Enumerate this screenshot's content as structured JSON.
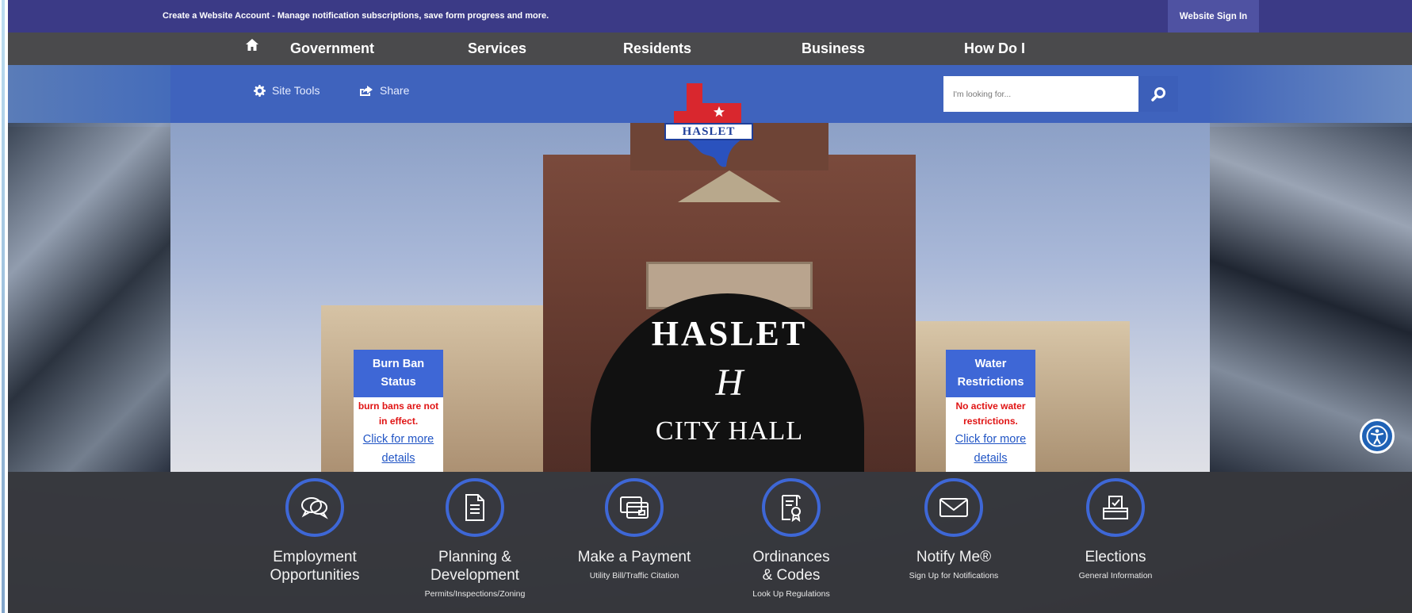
{
  "account_bar": {
    "message": "Create a Website Account - Manage notification subscriptions, save form progress and more.",
    "signin": "Website Sign In"
  },
  "nav": {
    "home_icon": "home-icon",
    "items": [
      "Government",
      "Services",
      "Residents",
      "Business",
      "How Do I"
    ]
  },
  "tools": {
    "site_tools": "Site Tools",
    "share": "Share",
    "search_placeholder": "I'm looking for..."
  },
  "logo": {
    "text": "HASLET"
  },
  "hero": {
    "awning_top": "HASLET",
    "awning_middle": "H",
    "awning_bottom": "CITY HALL"
  },
  "status_cards": [
    {
      "title_line1": "Burn Ban",
      "title_line2": "Status",
      "message_line1": "burn bans are not",
      "message_line2": "in effect.",
      "link_line1": "Click for more",
      "link_line2": "details"
    },
    {
      "title_line1": "Water",
      "title_line2": "Restrictions",
      "message_line1": "No active water",
      "message_line2": "restrictions.",
      "link_line1": "Click for more",
      "link_line2": "details"
    }
  ],
  "quick_links": [
    {
      "title_line1": "Employment",
      "title_line2": "Opportunities",
      "subtitle": "",
      "icon": "chat-bubbles-icon"
    },
    {
      "title_line1": "Planning &",
      "title_line2": "Development",
      "subtitle": "Permits/Inspections/Zoning",
      "icon": "document-icon"
    },
    {
      "title_line1": "Make a Payment",
      "title_line2": "",
      "subtitle": "Utility Bill/Traffic Citation",
      "icon": "credit-card-icon"
    },
    {
      "title_line1": "Ordinances",
      "title_line2": "& Codes",
      "subtitle": "Look Up Regulations",
      "icon": "certificate-icon"
    },
    {
      "title_line1": "Notify Me®",
      "title_line2": "",
      "subtitle": "Sign Up for Notifications",
      "icon": "envelope-icon"
    },
    {
      "title_line1": "Elections",
      "title_line2": "",
      "subtitle": "General Information",
      "icon": "ballot-box-icon"
    }
  ],
  "colors": {
    "account_bar": "#3b3a86",
    "nav_bar": "#4a4a4c",
    "tools_bar": "#3f63bd",
    "accent_blue": "#3e67d6",
    "alert_red": "#e01414"
  }
}
